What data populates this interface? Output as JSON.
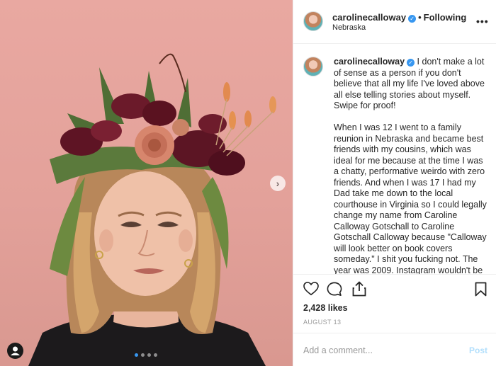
{
  "post": {
    "username": "carolinecalloway",
    "verified_mark": "✓",
    "separator": "•",
    "follow_state": "Following",
    "location": "Nebraska",
    "more_icon": "more-options-icon"
  },
  "caption": {
    "username": "carolinecalloway",
    "paragraphs": [
      "I don't make a lot of sense as a person if you don't believe that all my life I've loved above all else telling stories about myself. Swipe for proof!",
      "When I was 12 I went to a family reunion in Nebraska and became best friends with my cousins, which was ideal for me because at the time I was a chatty, performative weirdo with zero friends. And when I was 17 I had my Dad take me down to the local courthouse in Virginia so I could legally change my name from Caroline Calloway Gotschall to Caroline Gotschall Calloway because \"Calloway will look better on book covers someday.\" I shit you fucking not. The year was 2009. Instagram wouldn't be"
    ]
  },
  "actions": {
    "icons": [
      "heart-icon",
      "comment-icon",
      "share-icon",
      "bookmark-icon"
    ]
  },
  "likes": "2,428 likes",
  "date": "AUGUST 13",
  "comment_box": {
    "placeholder": "Add a comment...",
    "post_label": "Post"
  },
  "carousel": {
    "next_arrow": "›",
    "slides": 4,
    "active_slide": 1
  },
  "colors": {
    "accent": "#3897f0",
    "photo_background": "#e3a19a",
    "post_disabled": "#b2dffc"
  }
}
